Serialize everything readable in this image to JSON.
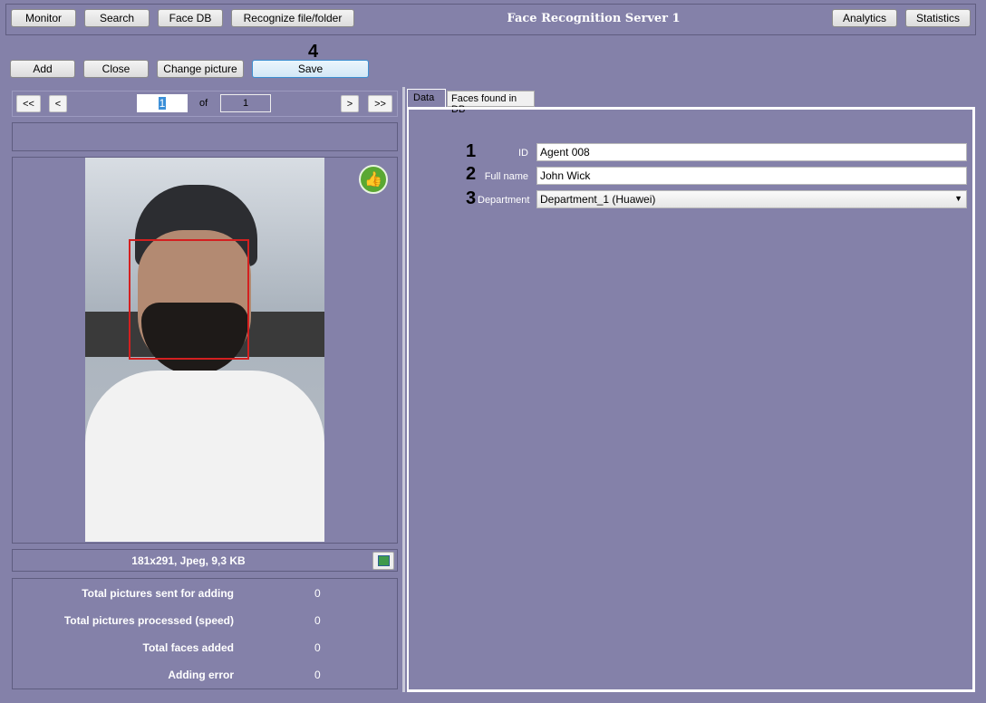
{
  "top_nav": {
    "monitor": "Monitor",
    "search": "Search",
    "face_db": "Face DB",
    "recognize": "Recognize file/folder",
    "title": "Face Recognition Server 1",
    "analytics": "Analytics",
    "statistics": "Statistics"
  },
  "toolbar": {
    "add": "Add",
    "close": "Close",
    "change_picture": "Change picture",
    "save": "Save",
    "save_marker": "4"
  },
  "pager": {
    "first": "<<",
    "prev": "<",
    "current": "1",
    "of": "of",
    "total": "1",
    "next": ">",
    "last": ">>"
  },
  "image_info": "181x291, Jpeg, 9,3 KB",
  "stats": [
    {
      "label": "Total pictures sent for adding",
      "value": "0"
    },
    {
      "label": "Total pictures processed (speed)",
      "value": "0"
    },
    {
      "label": "Total faces added",
      "value": "0"
    },
    {
      "label": "Adding error",
      "value": "0"
    }
  ],
  "tabs": [
    {
      "label": "Data"
    },
    {
      "label": "Faces found in DB"
    }
  ],
  "form": {
    "id": {
      "marker": "1",
      "label": "ID",
      "value": "Agent 008"
    },
    "full_name": {
      "marker": "2",
      "label": "Full name",
      "value": "John Wick"
    },
    "department": {
      "marker": "3",
      "label": "Department",
      "value": "Department_1 (Huawei)"
    }
  }
}
